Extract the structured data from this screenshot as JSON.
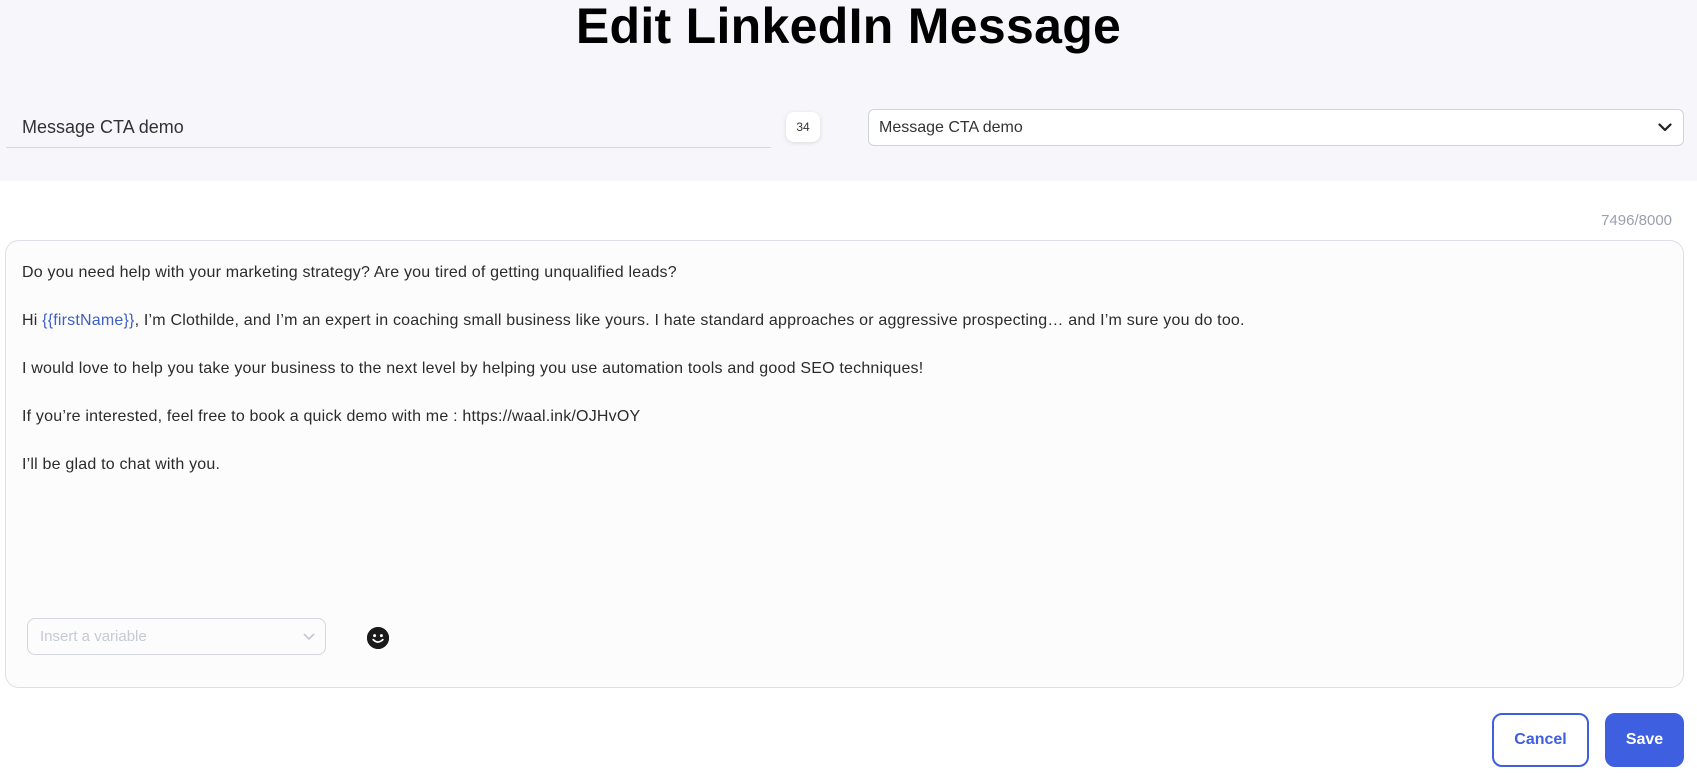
{
  "page": {
    "title": "Edit LinkedIn Message"
  },
  "header": {
    "message_name_value": "Message CTA demo",
    "message_name_char_count": "34",
    "template_select_value": "Message CTA demo",
    "template_select_icon": "chevron-down-icon"
  },
  "editor": {
    "char_counter": "7496/8000",
    "paragraphs": {
      "p1": "Do you need help with your marketing strategy? Are you tired of getting unqualified leads?",
      "p2_prefix": "Hi ",
      "p2_variable": "{{firstName}}",
      "p2_suffix": ", I’m Clothilde, and I’m an expert in coaching small business like yours. I hate standard approaches or aggressive prospecting… and I’m sure you do too.",
      "p3": "I would love to help you take your business to the next level by helping you use automation tools and good SEO techniques!",
      "p4": "If you’re interested, feel free to book a quick demo with me : https://waal.ink/OJHvOY",
      "p5": "I’ll be glad to chat with you."
    },
    "variable_color": "#3d5fc4",
    "insert_variable_placeholder": "Insert a variable",
    "insert_variable_icon": "chevron-down-icon",
    "emoji_icon": "smiley-icon"
  },
  "actions": {
    "cancel_label": "Cancel",
    "save_label": "Save",
    "accent_color": "#3e5fe0"
  }
}
